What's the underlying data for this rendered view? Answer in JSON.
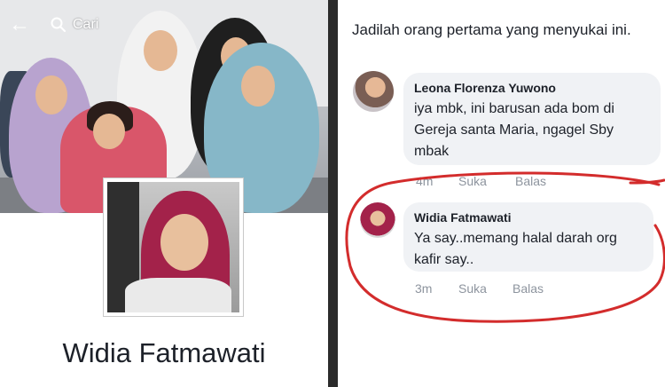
{
  "profile": {
    "search_label": "Cari",
    "name": "Widia Fatmawati"
  },
  "comments": {
    "first_like_prompt": "Jadilah orang pertama yang menyukai ini.",
    "items": [
      {
        "author": "Leona Florenza Yuwono",
        "text": "iya mbk, ini barusan ada bom di Gereja santa Maria, ngagel Sby mbak",
        "time": "4m",
        "like_label": "Suka",
        "reply_label": "Balas"
      },
      {
        "author": "Widia Fatmawati",
        "text": "Ya say..memang halal darah org kafir say..",
        "time": "3m",
        "like_label": "Suka",
        "reply_label": "Balas"
      }
    ]
  },
  "colors": {
    "annotation_circle": "#d32c2c",
    "bubble_bg": "#f0f2f5",
    "meta_text": "#8d949e"
  }
}
